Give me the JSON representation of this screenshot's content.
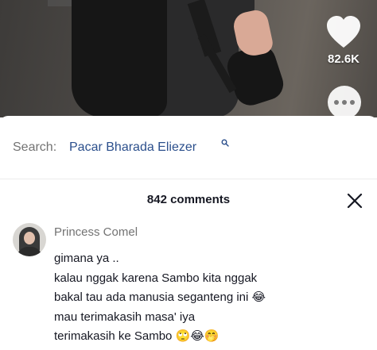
{
  "video": {
    "like_count": "82.6K",
    "icons": {
      "like": "heart-icon",
      "share": "more-dots-icon"
    }
  },
  "search": {
    "prefix": "Search:",
    "query": "Pacar Bharada Eliezer",
    "icon": "search-icon"
  },
  "comments": {
    "count_label": "842 comments",
    "close_icon": "close-icon",
    "items": [
      {
        "username": "Princess Comel",
        "lines": [
          "gimana ya ..",
          "kalau nggak karena Sambo kita nggak",
          "bakal tau ada manusia seganteng ini 😂",
          "mau terimakasih masa' iya",
          "terimakasih ke Sambo 🙄😂🤭"
        ]
      }
    ]
  },
  "colors": {
    "search_query": "#2b4f8c",
    "muted_text": "#737373",
    "primary_text": "#161823"
  }
}
